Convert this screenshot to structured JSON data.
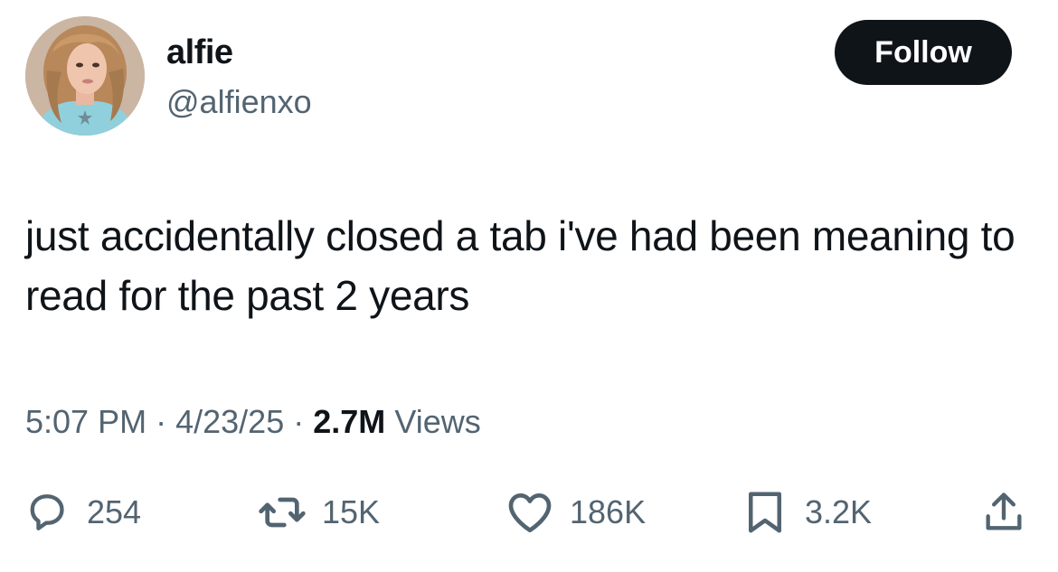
{
  "user": {
    "display_name": "alfie",
    "handle": "@alfienxo",
    "avatar_icon": "profile-photo"
  },
  "follow_button": {
    "label": "Follow"
  },
  "tweet": {
    "text": "just accidentally closed a tab i've had been meaning to read for the past 2 years",
    "time": "5:07 PM",
    "separator": "·",
    "date": "4/23/25",
    "views_count": "2.7M",
    "views_label": "Views"
  },
  "actions": {
    "replies": {
      "icon": "reply-icon",
      "count": "254"
    },
    "retweets": {
      "icon": "retweet-icon",
      "count": "15K"
    },
    "likes": {
      "icon": "heart-icon",
      "count": "186K"
    },
    "bookmarks": {
      "icon": "bookmark-icon",
      "count": "3.2K"
    },
    "share": {
      "icon": "share-icon"
    }
  },
  "colors": {
    "text_primary": "#0f1419",
    "text_secondary": "#536471",
    "button_bg": "#0f1419",
    "button_text": "#ffffff",
    "background": "#ffffff"
  }
}
